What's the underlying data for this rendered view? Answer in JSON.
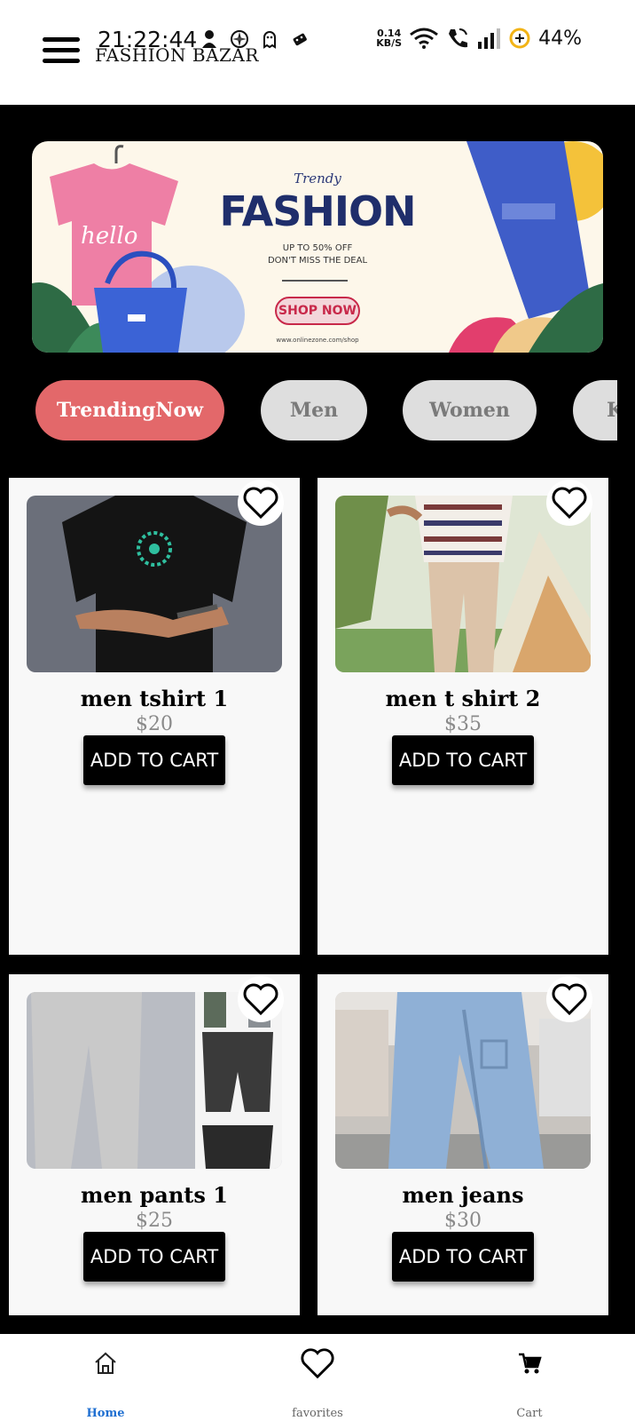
{
  "status_bar": {
    "time": "21:22:44",
    "net_speed_value": "0.14",
    "net_speed_unit": "KB/S",
    "battery": "44%"
  },
  "header": {
    "title": "FASHION BAZAR",
    "menu_icon": "hamburger-menu-icon"
  },
  "banner": {
    "kicker": "Trendy",
    "headline": "FASHION",
    "line1": "UP TO 50% OFF",
    "line2": "DON'T MISS THE DEAL",
    "cta": "SHOP NOW",
    "url": "www.onlinezone.com/shop"
  },
  "categories": [
    {
      "label": "TrendingNow",
      "active": true
    },
    {
      "label": "Men",
      "active": false
    },
    {
      "label": "Women",
      "active": false
    },
    {
      "label": "K",
      "active": false
    }
  ],
  "products": [
    {
      "name": "men tshirt 1",
      "price": "$20",
      "button": "ADD TO CART",
      "image": "black-tshirt"
    },
    {
      "name": "men t shirt 2",
      "price": "$35",
      "button": "ADD TO CART",
      "image": "patterned-tshirt"
    },
    {
      "name": "men pants 1",
      "price": "$25",
      "button": "ADD TO CART",
      "image": "grey-pants"
    },
    {
      "name": "men jeans",
      "price": "$30",
      "button": "ADD TO CART",
      "image": "blue-jeans"
    }
  ],
  "bottom_nav": {
    "items": [
      {
        "label": "Home",
        "icon": "home-icon",
        "active": true
      },
      {
        "label": "favorites",
        "icon": "heart-icon",
        "active": false
      },
      {
        "label": "Cart",
        "icon": "cart-icon",
        "active": false
      }
    ]
  },
  "colors": {
    "active_chip": "#e3686a",
    "inactive_chip": "#dedede",
    "active_nav": "#1f6fd1"
  }
}
